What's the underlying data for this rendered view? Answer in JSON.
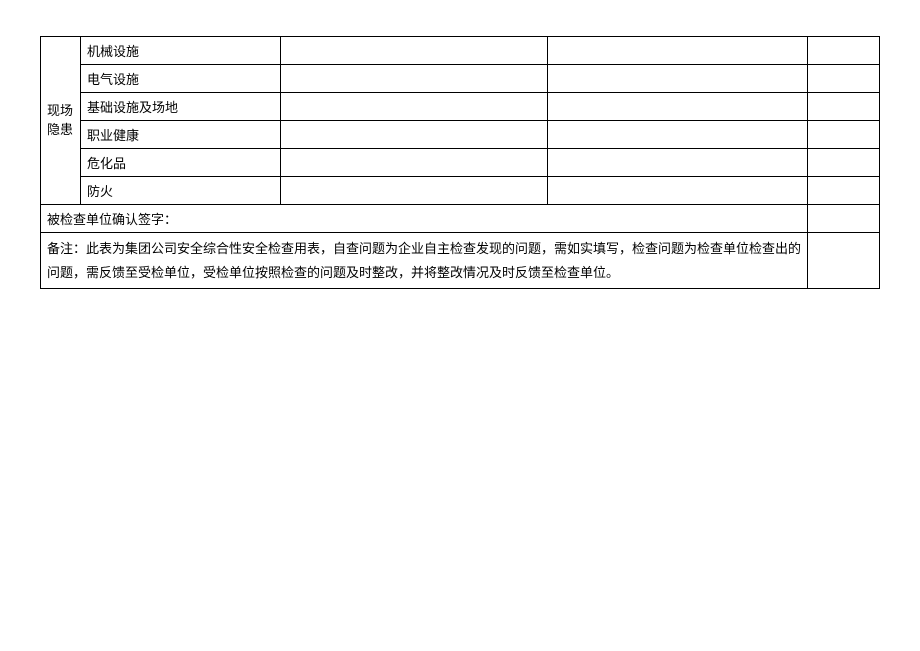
{
  "table": {
    "category": "现场隐患",
    "rows": [
      {
        "label": "机械设施"
      },
      {
        "label": "电气设施"
      },
      {
        "label": "基础设施及场地"
      },
      {
        "label": "职业健康"
      },
      {
        "label": "危化品"
      },
      {
        "label": "防火"
      }
    ],
    "signature_label": "被检查单位确认签字：",
    "note_text": "备注：此表为集团公司安全综合性安全检查用表，自查问题为企业自主检查发现的问题，需如实填写，检查问题为检查单位检查出的问题，需反馈至受检单位，受检单位按照检查的问题及时整改，并将整改情况及时反馈至检查单位。"
  }
}
